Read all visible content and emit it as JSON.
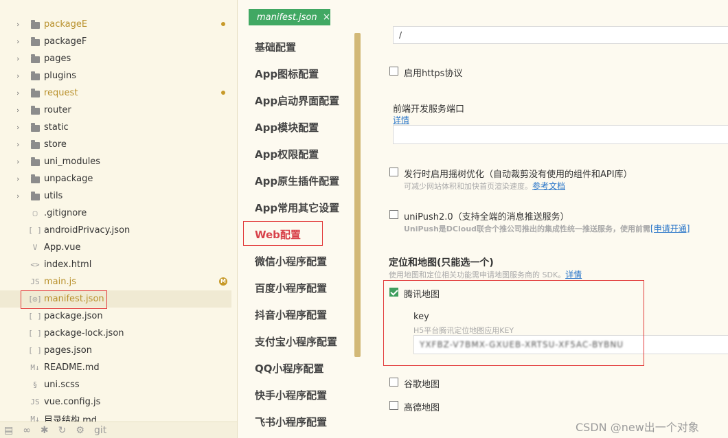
{
  "tree": {
    "items": [
      {
        "name": "packageE",
        "type": "folder",
        "modified": true
      },
      {
        "name": "packageF",
        "type": "folder"
      },
      {
        "name": "pages",
        "type": "folder"
      },
      {
        "name": "plugins",
        "type": "folder"
      },
      {
        "name": "request",
        "type": "folder",
        "modified": true
      },
      {
        "name": "router",
        "type": "folder"
      },
      {
        "name": "static",
        "type": "folder"
      },
      {
        "name": "store",
        "type": "folder"
      },
      {
        "name": "uni_modules",
        "type": "folder"
      },
      {
        "name": "unpackage",
        "type": "folder"
      },
      {
        "name": "utils",
        "type": "folder"
      },
      {
        "name": ".gitignore",
        "type": "file",
        "icon": "file-icon"
      },
      {
        "name": "androidPrivacy.json",
        "type": "file",
        "icon": "json-icon"
      },
      {
        "name": "App.vue",
        "type": "file",
        "icon": "vue-icon"
      },
      {
        "name": "index.html",
        "type": "file",
        "icon": "html-icon"
      },
      {
        "name": "main.js",
        "type": "file",
        "icon": "js-icon",
        "modified": true,
        "badge": "M"
      },
      {
        "name": "manifest.json",
        "type": "file",
        "icon": "manifest-icon",
        "modified": true,
        "selected": true
      },
      {
        "name": "package.json",
        "type": "file",
        "icon": "json-icon"
      },
      {
        "name": "package-lock.json",
        "type": "file",
        "icon": "json-icon"
      },
      {
        "name": "pages.json",
        "type": "file",
        "icon": "json-icon"
      },
      {
        "name": "README.md",
        "type": "file",
        "icon": "markdown-icon"
      },
      {
        "name": "uni.scss",
        "type": "file",
        "icon": "scss-icon"
      },
      {
        "name": "vue.config.js",
        "type": "file",
        "icon": "js-icon"
      },
      {
        "name": "目录结构.md",
        "type": "file",
        "icon": "markdown-icon"
      }
    ],
    "bottom_icons": [
      "explorer-icon",
      "bike-icon",
      "bug-icon",
      "refresh-icon",
      "plugin-icon",
      "git-icon"
    ],
    "bottom_git_label": "git"
  },
  "tab": {
    "label": "manifest.json",
    "close": "×"
  },
  "nav": {
    "items": [
      {
        "label": "基础配置"
      },
      {
        "label": "App图标配置"
      },
      {
        "label": "App启动界面配置"
      },
      {
        "label": "App模块配置"
      },
      {
        "label": "App权限配置"
      },
      {
        "label": "App原生插件配置"
      },
      {
        "label": "App常用其它设置"
      },
      {
        "label": "Web配置",
        "active": true
      },
      {
        "label": "微信小程序配置"
      },
      {
        "label": "百度小程序配置"
      },
      {
        "label": "抖音小程序配置"
      },
      {
        "label": "支付宝小程序配置"
      },
      {
        "label": "QQ小程序配置"
      },
      {
        "label": "快手小程序配置"
      },
      {
        "label": "飞书小程序配置"
      }
    ]
  },
  "content": {
    "top_input_value": "/",
    "https": {
      "label": "启用https协议",
      "checked": false
    },
    "port": {
      "label": "前端开发服务端口",
      "link": "详情",
      "value": ""
    },
    "treeshake": {
      "label": "发行时启用摇树优化（自动裁剪没有使用的组件和API库）",
      "hint": "可减少网站体积和加快首页渲染速度。",
      "link": "参考文档",
      "checked": false
    },
    "unipush": {
      "label": "uniPush2.0（支持全端的消息推送服务）",
      "hint": "UniPush是DCloud联合个推公司推出的集成性统一推送服务，使用前需",
      "link": "[申请开通]",
      "checked": false
    },
    "map": {
      "title": "定位和地图(只能选一个)",
      "hint": "使用地图和定位相关功能需申请地图服务商的 SDK。",
      "link": "详情",
      "tencent": {
        "label": "腾讯地图",
        "checked": true
      },
      "key_label": "key",
      "key_hint": "H5平台腾讯定位地图应用KEY",
      "key_value": "YXFBZ-V7BMX-GXUEB-XRTSU-XF5AC-BYBNU",
      "google": {
        "label": "谷歌地图",
        "checked": false
      },
      "amap": {
        "label": "高德地图",
        "checked": false
      }
    }
  },
  "watermark": "CSDN @new出一个对象",
  "colors": {
    "tab_bg": "#41a863",
    "accent_red": "#e23a3a",
    "modified": "#b8902b",
    "scrollbar": "#d2b877"
  }
}
